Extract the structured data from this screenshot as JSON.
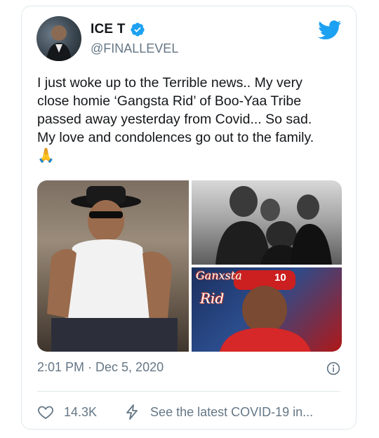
{
  "author": {
    "name": "ICE T",
    "handle": "@FINALLEVEL",
    "verified": true
  },
  "tweet": {
    "lines": [
      "I just woke up to the Terrible news.. My very",
      "close homie ‘Gangsta Rid’ of Boo-Yaa Tribe",
      "passed away yesterday from Covid... So sad.",
      "My love and condolences go out to the family."
    ],
    "emoji": "🙏"
  },
  "media": {
    "overlay_text_1": "Ganxsta",
    "overlay_text_2": "Rid",
    "overlay_number": "10"
  },
  "meta": {
    "time": "2:01 PM · Dec 5, 2020"
  },
  "actions": {
    "likes": "14.3K",
    "covid_link": "See the latest COVID-19 in..."
  },
  "colors": {
    "twitter_blue": "#1da1f2",
    "secondary_text": "#657786",
    "border": "#e1e8ed"
  }
}
